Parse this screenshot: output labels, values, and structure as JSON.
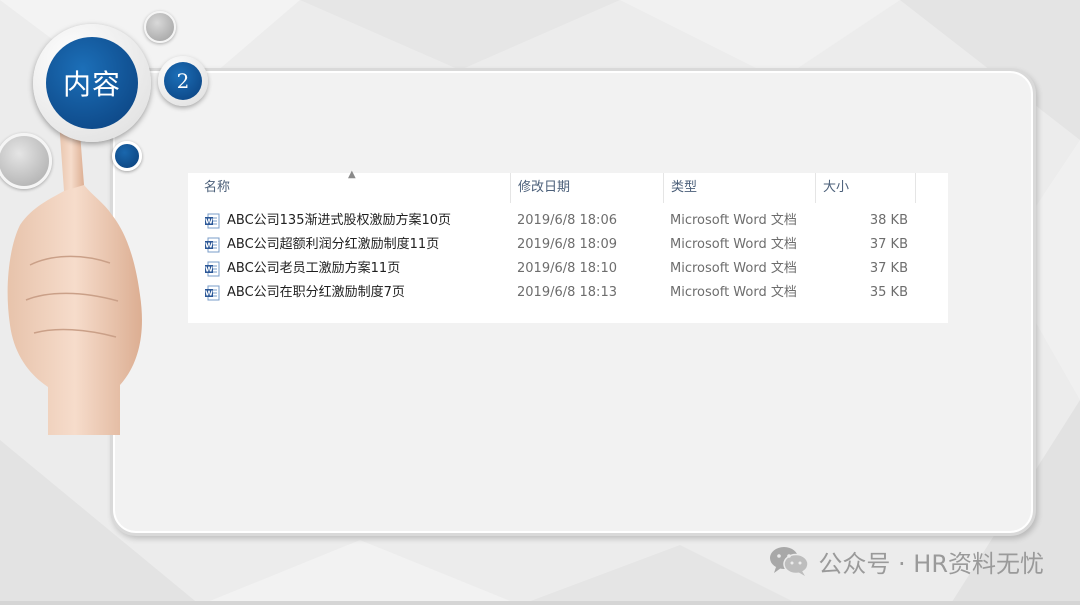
{
  "slide": {
    "badge_label": "内容",
    "badge_number": "2"
  },
  "explorer": {
    "columns": {
      "name": "名称",
      "modified": "修改日期",
      "type": "类型",
      "size": "大小"
    },
    "files": [
      {
        "name": "ABC公司135渐进式股权激励方案10页",
        "modified": "2019/6/8 18:06",
        "type": "Microsoft Word 文档",
        "size": "38 KB",
        "icon": "word-doc-icon"
      },
      {
        "name": "ABC公司超额利润分红激励制度11页",
        "modified": "2019/6/8 18:09",
        "type": "Microsoft Word 文档",
        "size": "37 KB",
        "icon": "word-doc-icon"
      },
      {
        "name": "ABC公司老员工激励方案11页",
        "modified": "2019/6/8 18:10",
        "type": "Microsoft Word 文档",
        "size": "37 KB",
        "icon": "word-doc-icon"
      },
      {
        "name": "ABC公司在职分红激励制度7页",
        "modified": "2019/6/8 18:13",
        "type": "Microsoft Word 文档",
        "size": "35 KB",
        "icon": "word-doc-icon"
      }
    ]
  },
  "watermark": {
    "text": "公众号 · HR资料无忧",
    "icon": "wechat-icon"
  },
  "colors": {
    "accent_blue": "#0b4a8c",
    "word_blue": "#2b5797"
  }
}
